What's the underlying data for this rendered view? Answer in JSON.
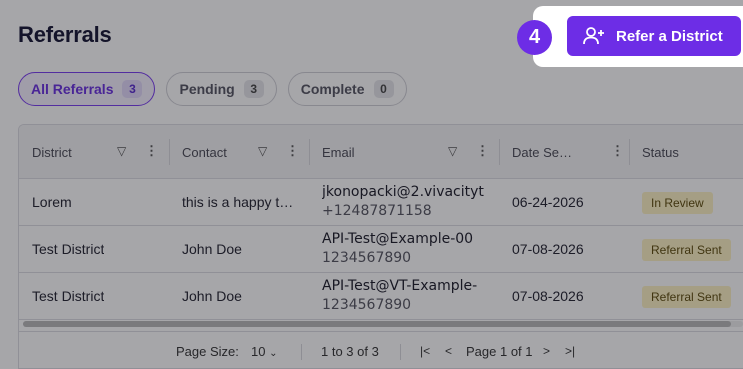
{
  "page": {
    "title": "Referrals",
    "refer_button_label": "Refer a District",
    "step_number": "4"
  },
  "tabs": [
    {
      "label": "All Referrals",
      "count": "3",
      "active": true
    },
    {
      "label": "Pending",
      "count": "3",
      "active": false
    },
    {
      "label": "Complete",
      "count": "0",
      "active": false
    }
  ],
  "table": {
    "columns": [
      "District",
      "Contact",
      "Email",
      "Date Se…",
      "Status"
    ],
    "rows": [
      {
        "district": "Lorem",
        "contact": "this is a happy t…",
        "email": "jkonopacki@2.vivacityt",
        "phone": "+12487871158",
        "date": "06-24-2026",
        "status": "In Review"
      },
      {
        "district": "Test District",
        "contact": "John Doe",
        "email": "API-Test@Example-00",
        "phone": "1234567890",
        "date": "07-08-2026",
        "status": "Referral Sent"
      },
      {
        "district": "Test District",
        "contact": "John Doe",
        "email": "API-Test@VT-Example-",
        "phone": "1234567890",
        "date": "07-08-2026",
        "status": "Referral Sent"
      }
    ]
  },
  "pagination": {
    "page_size_label": "Page Size:",
    "page_size_value": "10",
    "range_text": "1 to 3 of 3",
    "page_text": "Page 1 of 1"
  },
  "colors": {
    "accent": "#6d2de6",
    "badge_bg": "#fdf3c4",
    "overlay": "rgba(20,20,30,0.38)"
  }
}
